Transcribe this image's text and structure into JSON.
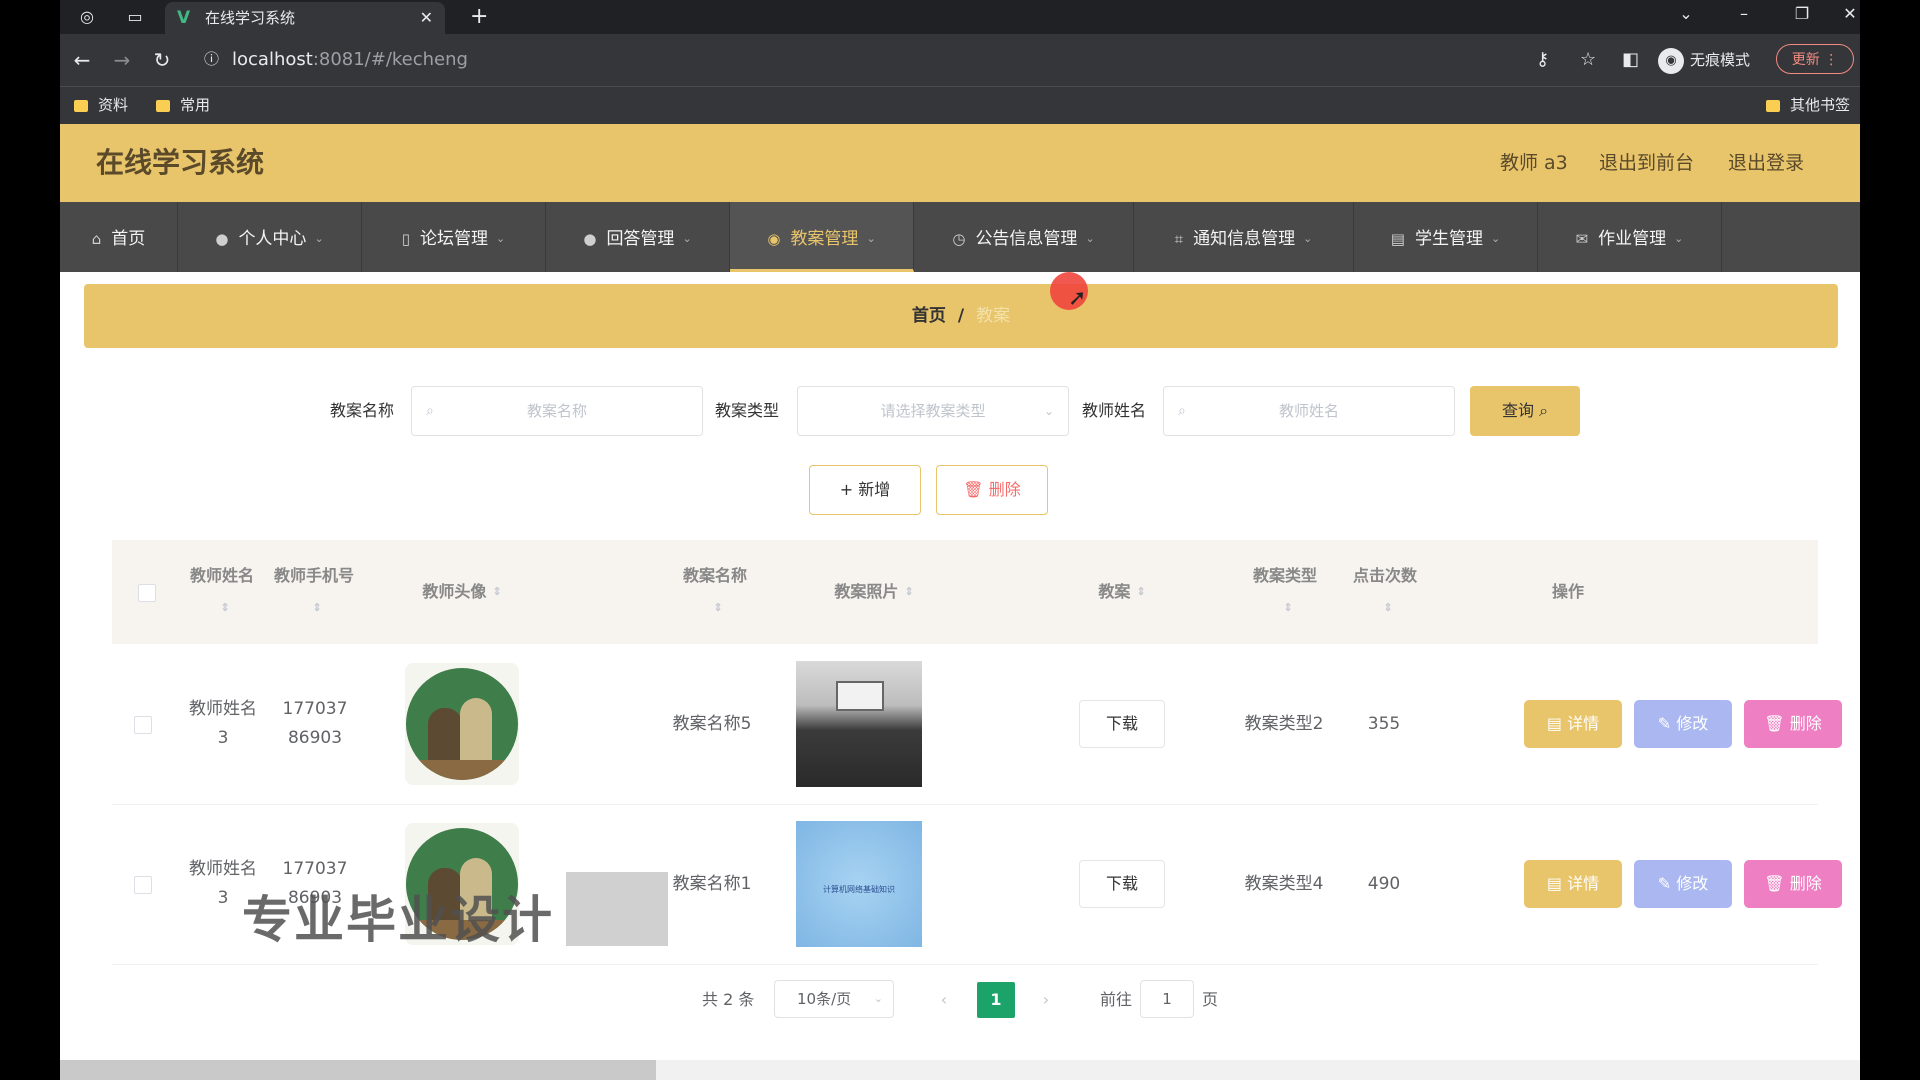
{
  "browser": {
    "tab_title": "在线学习系统",
    "tab_favicon": "V",
    "url_host": "localhost",
    "url_rest": ":8081/#/kecheng",
    "incognito_label": "无痕模式",
    "update_label": "更新",
    "bookmarks": [
      "资料",
      "常用"
    ],
    "other_bookmarks": "其他书签"
  },
  "header": {
    "title": "在线学习系统",
    "user": "教师 a3",
    "back_to_front": "退出到前台",
    "logout": "退出登录"
  },
  "menu": [
    {
      "label": "首页",
      "icon": "home-icon",
      "glyph": "⌂"
    },
    {
      "label": "个人中心",
      "icon": "user-icon",
      "glyph": "●"
    },
    {
      "label": "论坛管理",
      "icon": "forum-icon",
      "glyph": "▯"
    },
    {
      "label": "回答管理",
      "icon": "user-icon",
      "glyph": "●"
    },
    {
      "label": "教案管理",
      "icon": "pin-icon",
      "glyph": "◉"
    },
    {
      "label": "公告信息管理",
      "icon": "clock-icon",
      "glyph": "◷"
    },
    {
      "label": "通知信息管理",
      "icon": "crop-icon",
      "glyph": "⌗"
    },
    {
      "label": "学生管理",
      "icon": "bank-icon",
      "glyph": "▤"
    },
    {
      "label": "作业管理",
      "icon": "mail-icon",
      "glyph": "✉"
    }
  ],
  "breadcrumb": {
    "home": "首页",
    "sep": "/",
    "current": "教案"
  },
  "filters": {
    "name_label": "教案名称",
    "name_placeholder": "教案名称",
    "type_label": "教案类型",
    "type_placeholder": "请选择教案类型",
    "teacher_label": "教师姓名",
    "teacher_placeholder": "教师姓名",
    "query_label": "查询"
  },
  "actions": {
    "add_label": "新增",
    "delete_label": "删除"
  },
  "table": {
    "columns": {
      "teacher_name": "教师姓名",
      "teacher_phone": "教师手机号",
      "teacher_avatar": "教师头像",
      "lesson_name": "教案名称",
      "lesson_photo": "教案照片",
      "lesson_file": "教案",
      "lesson_type": "教案类型",
      "clicks": "点击次数",
      "ops": "操作"
    },
    "rows": [
      {
        "teacher_name": "教师姓名3",
        "teacher_phone": "17703786903",
        "lesson_name": "教案名称5",
        "download": "下载",
        "lesson_type": "教案类型2",
        "clicks": "355",
        "photo_text": ""
      },
      {
        "teacher_name": "教师姓名3",
        "teacher_phone": "17703786903",
        "lesson_name": "教案名称1",
        "download": "下载",
        "lesson_type": "教案类型4",
        "clicks": "490",
        "photo_text": "计算机网络基础知识"
      }
    ],
    "op_detail": "详情",
    "op_edit": "修改",
    "op_delete": "删除"
  },
  "pagination": {
    "total": "共 2 条",
    "page_size": "10条/页",
    "current_page": "1",
    "goto_label": "前往",
    "goto_value": "1",
    "page_unit": "页"
  },
  "watermark": "专业毕业设计",
  "colors": {
    "accent": "#e8c46b",
    "menu_bg": "#494949",
    "pager_active": "#1ca36a"
  }
}
